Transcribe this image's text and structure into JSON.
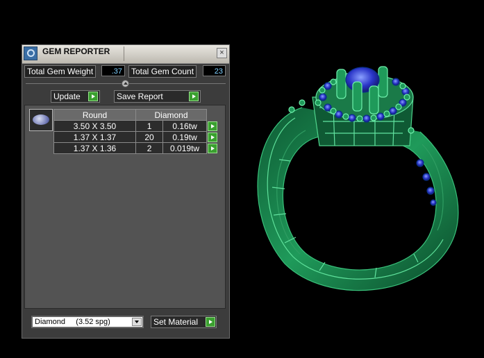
{
  "window": {
    "title": "GEM REPORTER",
    "close": "×"
  },
  "totals": {
    "weight_label": "Total Gem Weight",
    "weight_value": ".37",
    "count_label": "Total Gem Count",
    "count_value": "23"
  },
  "buttons": {
    "update": "Update",
    "save_report": "Save Report",
    "set_material": "Set Material"
  },
  "table": {
    "headers": [
      "Round",
      "Diamond"
    ],
    "rows": [
      {
        "size": "3.50 X 3.50",
        "count": "1",
        "weight": "0.16tw"
      },
      {
        "size": "1.37 X 1.37",
        "count": "20",
        "weight": "0.19tw"
      },
      {
        "size": "1.37 X 1.36",
        "count": "2",
        "weight": "0.019tw"
      }
    ]
  },
  "material": {
    "selected": "Diamond     (3.52 spg)"
  },
  "icons": [
    "app-icon",
    "close-icon",
    "slider-knob",
    "go-arrow-icon",
    "dropdown-arrow-icon",
    "gem-oval-icon"
  ],
  "colors": {
    "wireframe": "#1f9a5a",
    "gem": "#2a35c8",
    "accent_go": "#3aa02f",
    "value_text": "#7fd0ff"
  }
}
